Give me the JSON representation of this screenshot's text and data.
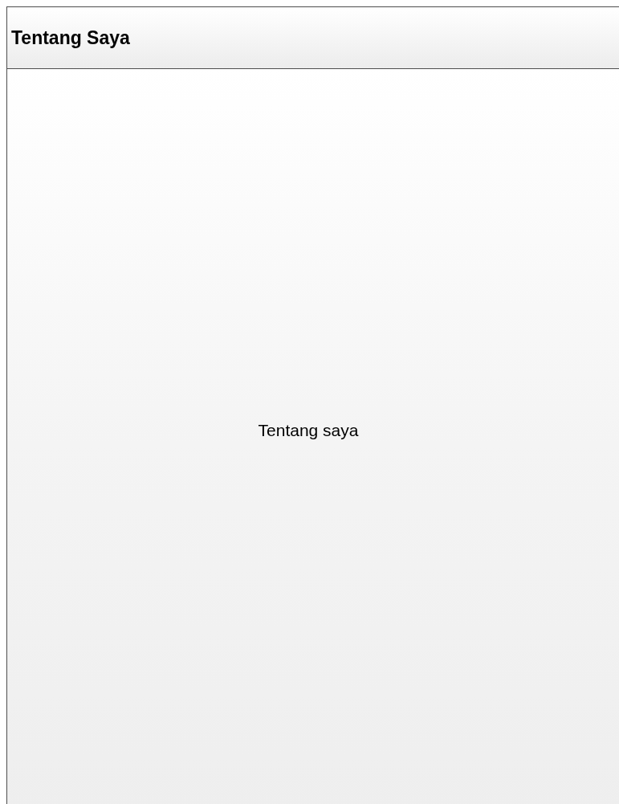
{
  "header": {
    "title": "Tentang Saya"
  },
  "content": {
    "text": "Tentang saya"
  }
}
